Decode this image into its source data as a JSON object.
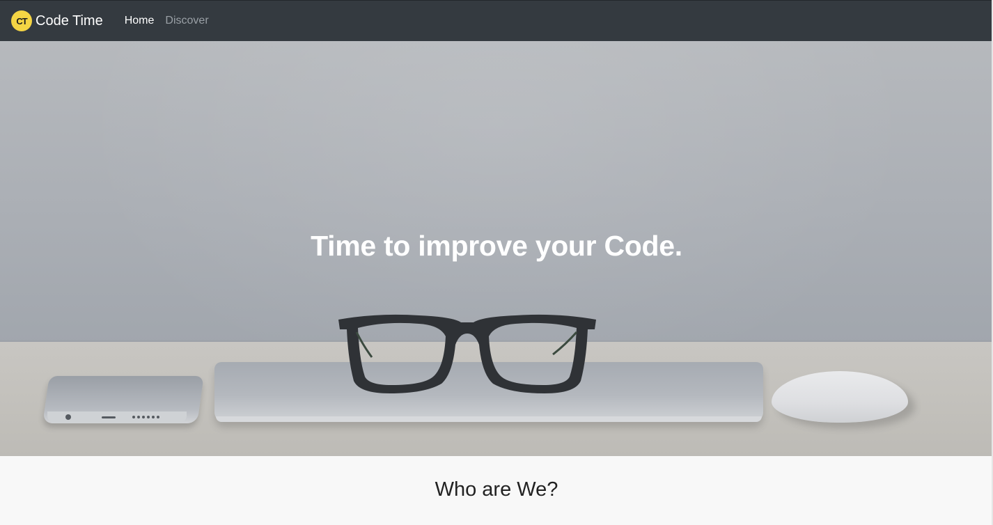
{
  "navbar": {
    "logo_text": "CT",
    "brand": "Code Time",
    "links": [
      {
        "label": "Home",
        "active": true
      },
      {
        "label": "Discover",
        "active": false
      }
    ]
  },
  "hero": {
    "title_part1": "Time",
    "title_part2": " to improve your ",
    "title_part3": "Code."
  },
  "section": {
    "title": "Who are We?"
  },
  "colors": {
    "navbar_bg": "#343a40",
    "logo_bg": "#f5d544",
    "section_bg": "#f8f8f8"
  }
}
